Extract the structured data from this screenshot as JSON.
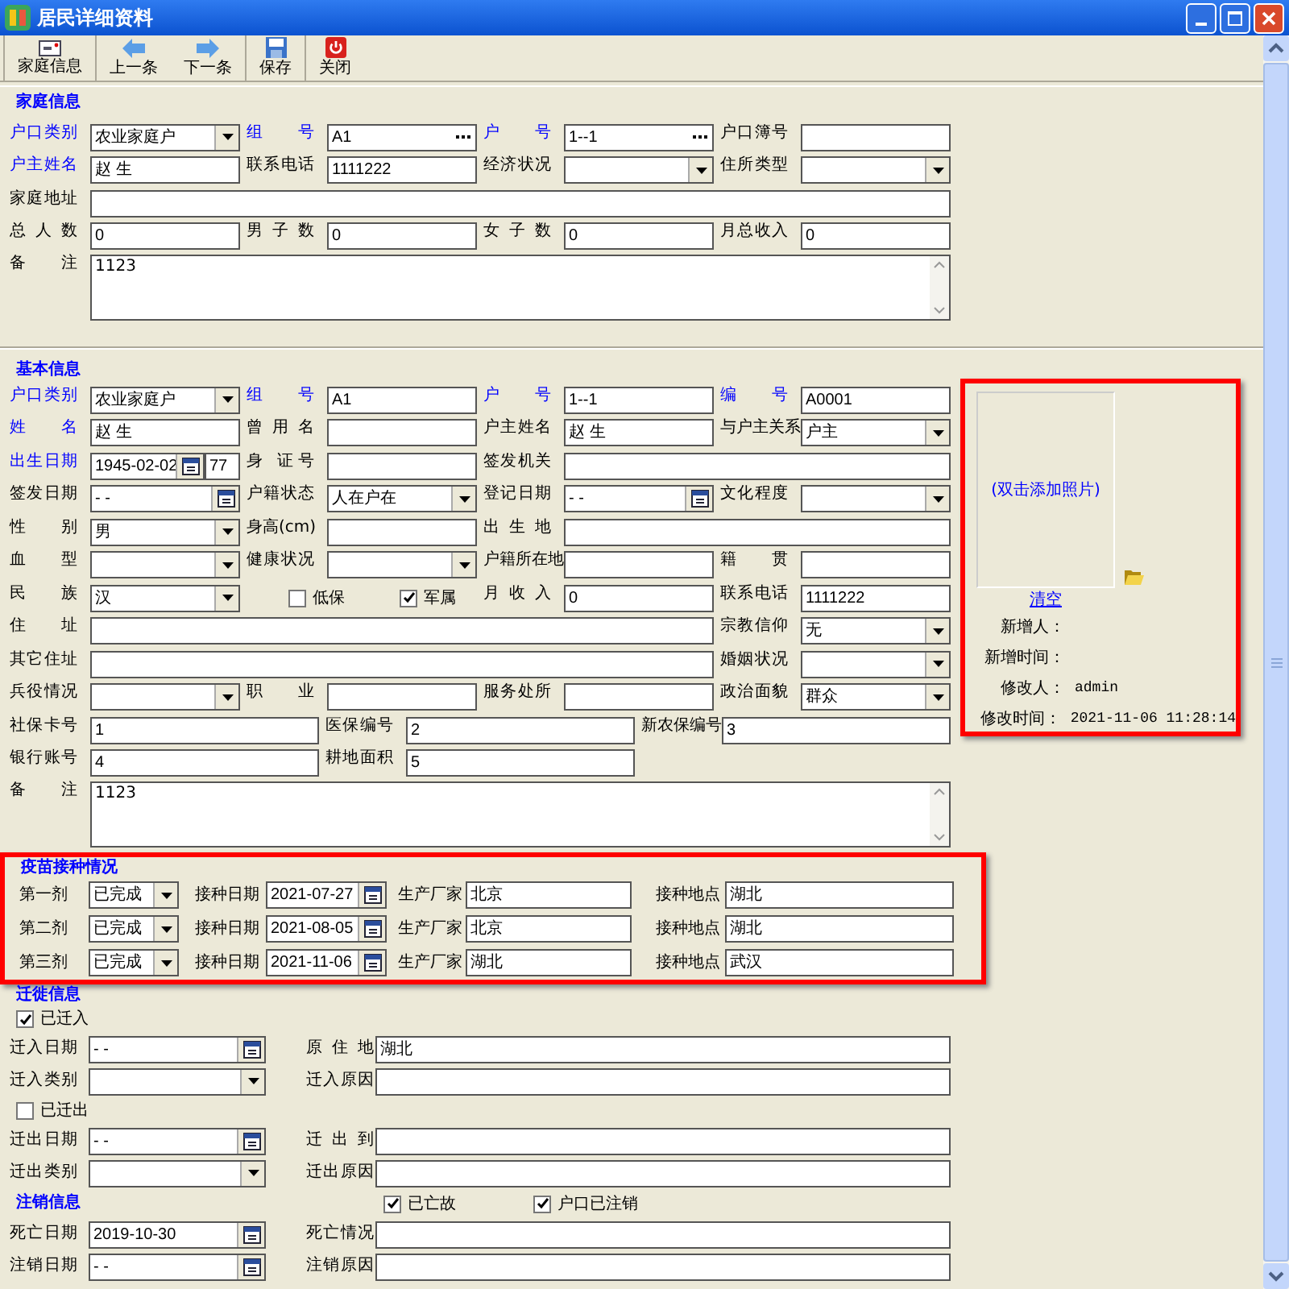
{
  "window": {
    "title": "居民详细资料"
  },
  "toolbar": [
    [
      {
        "label": "家庭信息",
        "kind": "card"
      }
    ],
    [
      {
        "label": "上一条",
        "kind": "prev"
      },
      {
        "label": "下一条",
        "kind": "next"
      }
    ],
    [
      {
        "label": "保存",
        "kind": "save"
      }
    ],
    [
      {
        "label": "关闭",
        "kind": "power"
      }
    ]
  ],
  "family": {
    "title": "家庭信息",
    "rows": [
      [
        {
          "label": "户口类别",
          "required": true,
          "kind": "select",
          "value": "农业家庭户"
        },
        {
          "label": "组 号",
          "required": true,
          "kind": "lookup",
          "value": "A1"
        },
        {
          "label": "户 号",
          "required": true,
          "kind": "lookup",
          "value": "1--1"
        },
        {
          "label": "户口簿号",
          "required": false,
          "kind": "text"
        }
      ],
      [
        {
          "label": "户主姓名",
          "required": true,
          "kind": "text",
          "value": "赵 生"
        },
        {
          "label": "联系电话",
          "required": false,
          "kind": "text",
          "value": "1111222"
        },
        {
          "label": "经济状况",
          "required": false,
          "kind": "select"
        },
        {
          "label": "住所类型",
          "required": false,
          "kind": "select"
        }
      ],
      [
        {
          "label": "家庭地址",
          "required": false,
          "kind": "wide"
        }
      ],
      [
        {
          "label": "总 人 数",
          "required": false,
          "kind": "text",
          "value": "0"
        },
        {
          "label": "男 子 数",
          "required": false,
          "kind": "text",
          "value": "0"
        },
        {
          "label": "女 子 数",
          "required": false,
          "kind": "text",
          "value": "0"
        },
        {
          "label": "月总收入",
          "required": false,
          "kind": "text",
          "value": "0"
        }
      ],
      [
        {
          "label": "备 注",
          "required": false,
          "kind": "memo",
          "value": "1123"
        }
      ]
    ]
  },
  "basic": {
    "title": "基本信息",
    "rows": [
      [
        {
          "label": "户口类别",
          "required": true,
          "kind": "select",
          "value": "农业家庭户"
        },
        {
          "label": "组 号",
          "required": true,
          "kind": "text",
          "value": "A1"
        },
        {
          "label": "户 号",
          "required": true,
          "kind": "text",
          "value": "1--1"
        },
        {
          "label": "编 号",
          "required": true,
          "kind": "text",
          "value": "A0001"
        }
      ],
      [
        {
          "label": "姓 名",
          "required": true,
          "kind": "text",
          "value": "赵 生"
        },
        {
          "label": "曾 用 名",
          "required": false,
          "kind": "text"
        },
        {
          "label": "户主姓名",
          "required": false,
          "kind": "text",
          "value": "赵 生"
        },
        {
          "label": "与户主关系",
          "required": false,
          "kind": "select",
          "value": "户主"
        }
      ],
      [
        {
          "label": "出生日期",
          "required": true,
          "kind": "birth",
          "value": "1945-02-02",
          "age": "77"
        },
        {
          "label": "身 证号",
          "required": false,
          "kind": "text"
        },
        {
          "label": "签发机关",
          "required": false,
          "kind": "wide"
        }
      ],
      [
        {
          "label": "签发日期",
          "required": false,
          "kind": "date",
          "value": "- -"
        },
        {
          "label": "户籍状态",
          "required": false,
          "kind": "select",
          "value": "人在户在"
        },
        {
          "label": "登记日期",
          "required": false,
          "kind": "date",
          "value": "- -"
        },
        {
          "label": "文化程度",
          "required": false,
          "kind": "select"
        }
      ],
      [
        {
          "label": "性 别",
          "required": false,
          "kind": "select",
          "value": "男"
        },
        {
          "label": "身高(cm)",
          "required": false,
          "kind": "text"
        },
        {
          "label": "出 生 地",
          "required": false,
          "kind": "wide"
        }
      ],
      [
        {
          "label": "血 型",
          "required": false,
          "kind": "select"
        },
        {
          "label": "健康状况",
          "required": false,
          "kind": "select"
        },
        {
          "label": "户籍所在地",
          "required": false,
          "kind": "text"
        },
        {
          "label": "籍 贯",
          "required": false,
          "kind": "text"
        }
      ],
      [
        {
          "label": "民 族",
          "required": false,
          "kind": "select",
          "value": "汉"
        },
        {
          "kind": "checkboxes",
          "boxes": [
            {
              "label": "低保",
              "checked": false
            },
            {
              "label": "军属",
              "checked": true
            }
          ]
        },
        {
          "label": "月 收 入",
          "required": false,
          "kind": "text",
          "value": "0"
        },
        {
          "label": "联系电话",
          "required": false,
          "kind": "text",
          "value": "1111222"
        }
      ],
      [
        {
          "label": "住 址",
          "required": false,
          "kind": "wide"
        },
        {
          "label": "宗教信仰",
          "required": false,
          "kind": "select",
          "value": "无"
        }
      ],
      [
        {
          "label": "其它住址",
          "required": false,
          "kind": "wide"
        },
        {
          "label": "婚姻状况",
          "required": false,
          "kind": "select"
        }
      ],
      [
        {
          "label": "兵役情况",
          "required": false,
          "kind": "select"
        },
        {
          "label": "职 业",
          "required": false,
          "kind": "text"
        },
        {
          "label": "服务处所",
          "required": false,
          "kind": "text"
        },
        {
          "label": "政治面貌",
          "required": false,
          "kind": "select",
          "value": "群众"
        }
      ]
    ],
    "extra_rows": [
      [
        {
          "label": "社保卡号",
          "required": false,
          "kind": "text",
          "value": "1"
        },
        {
          "label": "医保编号",
          "required": false,
          "kind": "text",
          "value": "2"
        },
        {
          "label": "新农保编号",
          "required": false,
          "kind": "text",
          "value": "3"
        }
      ],
      [
        {
          "label": "银行账号",
          "required": false,
          "kind": "text",
          "value": "4"
        },
        {
          "label": "耕地面积",
          "required": false,
          "kind": "text",
          "value": "5"
        }
      ],
      [
        {
          "label": "备 注",
          "required": false,
          "kind": "memo",
          "value": "1123"
        }
      ]
    ],
    "photo": {
      "prompt": "(双击添加照片)",
      "clear_link": "清空",
      "info": [
        {
          "label": "新增人："
        },
        {
          "label": "新增时间："
        },
        {
          "label": "修改人：",
          "value": "admin"
        },
        {
          "label": "修改时间：",
          "value": "2021-11-06 11:28:14"
        }
      ]
    }
  },
  "vaccination": {
    "title": "疫苗接种情况",
    "doses": [
      {
        "label": "第一剂",
        "status": "已完成",
        "date_label": "接种日期",
        "date": "2021-07-27",
        "maker_label": "生产厂家",
        "maker": "北京",
        "place_label": "接种地点",
        "place": "湖北"
      },
      {
        "label": "第二剂",
        "status": "已完成",
        "date_label": "接种日期",
        "date": "2021-08-05",
        "maker_label": "生产厂家",
        "maker": "北京",
        "place_label": "接种地点",
        "place": "湖北"
      },
      {
        "label": "第三剂",
        "status": "已完成",
        "date_label": "接种日期",
        "date": "2021-11-06",
        "maker_label": "生产厂家",
        "maker": "湖北",
        "place_label": "接种地点",
        "place": "武汉"
      }
    ]
  },
  "migration": {
    "title": "迁徙信息",
    "groups": [
      {
        "check": {
          "label": "已迁入",
          "checked": true
        },
        "rows": [
          [
            {
              "label": "迁入日期",
              "kind": "date",
              "value": "- -"
            },
            {
              "label": "原 住 地",
              "kind": "text",
              "value": "湖北"
            }
          ],
          [
            {
              "label": "迁入类别",
              "kind": "select"
            },
            {
              "label": "迁入原因",
              "kind": "text"
            }
          ]
        ]
      },
      {
        "check": {
          "label": "已迁出",
          "checked": false
        },
        "rows": [
          [
            {
              "label": "迁出日期",
              "kind": "date",
              "value": "- -"
            },
            {
              "label": "迁 出 到",
              "kind": "text"
            }
          ],
          [
            {
              "label": "迁出类别",
              "kind": "select"
            },
            {
              "label": "迁出原因",
              "kind": "text"
            }
          ]
        ]
      }
    ]
  },
  "cancellation": {
    "title": "注销信息",
    "checks": [
      {
        "label": "已亡故",
        "checked": true
      },
      {
        "label": "户口已注销",
        "checked": true
      }
    ],
    "rows": [
      [
        {
          "label": "死亡日期",
          "kind": "date",
          "value": "2019-10-30"
        },
        {
          "label": "死亡情况",
          "kind": "text"
        }
      ],
      [
        {
          "label": "注销日期",
          "kind": "date",
          "value": "- -"
        },
        {
          "label": "注销原因",
          "kind": "text"
        }
      ]
    ]
  }
}
